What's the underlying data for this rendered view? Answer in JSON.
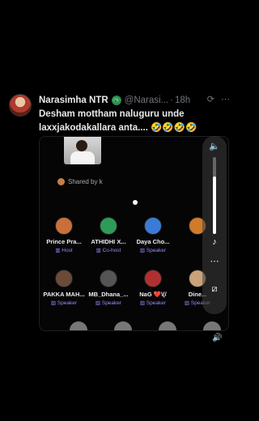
{
  "tweet": {
    "name": "Narasimha NTR",
    "badge": "🦚",
    "handle": "@Narasi...",
    "separator": "·",
    "time": "18h",
    "icons": [
      "refresh-icon",
      "more-icon"
    ],
    "text": "Desham mottham naluguru unde laxxjakodakallara anta.... 🤣🤣🤣🤣"
  },
  "space": {
    "shared_by": "Shared by k",
    "participants": [
      {
        "name": "Prince Pra...",
        "role": "Host",
        "color": "#c9703a"
      },
      {
        "name": "ATHIDHI X...",
        "role": "Co-host",
        "color": "#2f9a5a"
      },
      {
        "name": "Daya Cho...",
        "role": "Speaker",
        "color": "#3a7bd5"
      },
      {
        "name": "",
        "role": "",
        "color": "#d07a2a"
      },
      {
        "name": "PAKKA MAH...",
        "role": "Speaker",
        "color": "#6b4a3a"
      },
      {
        "name": "MB_Dhana_...",
        "role": "Speaker",
        "color": "#555"
      },
      {
        "name": "NaG ❤️\\(/",
        "role": "Speaker",
        "color": "#b03030"
      },
      {
        "name": "Dine...",
        "role": "Speaker",
        "color": "#caa27a"
      }
    ]
  },
  "controls": {
    "volume_level": 0.75,
    "icons": [
      "speaker-icon",
      "music-note-icon",
      "more-icon",
      "caption-off-icon",
      "volume-icon"
    ]
  }
}
